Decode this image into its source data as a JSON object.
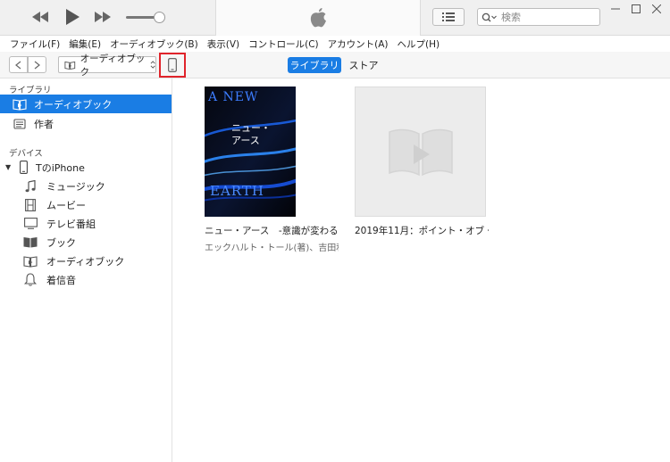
{
  "search": {
    "placeholder": "検索"
  },
  "menubar": [
    "ファイル(F)",
    "編集(E)",
    "オーディオブック(B)",
    "表示(V)",
    "コントロール(C)",
    "アカウント(A)",
    "ヘルプ(H)"
  ],
  "nav": {
    "media_kind": "オーディオブック",
    "library_label": "ライブラリ",
    "store_label": "ストア"
  },
  "sidebar": {
    "library_heading": "ライブラリ",
    "library_items": [
      {
        "label": "オーディオブック",
        "icon": "audiobook-icon",
        "selected": true
      },
      {
        "label": "作者",
        "icon": "author-icon",
        "selected": false
      }
    ],
    "devices_heading": "デバイス",
    "device_name": "TのiPhone",
    "device_items": [
      {
        "label": "ミュージック",
        "icon": "music-note-icon"
      },
      {
        "label": "ムービー",
        "icon": "film-icon"
      },
      {
        "label": "テレビ番組",
        "icon": "tv-icon"
      },
      {
        "label": "ブック",
        "icon": "book-icon"
      },
      {
        "label": "オーディオブック",
        "icon": "audiobook-icon"
      },
      {
        "label": "着信音",
        "icon": "bell-icon"
      }
    ]
  },
  "items": [
    {
      "title": "ニュー・アース　-意識が変わる...",
      "author": "エックハルト・トール(著)、吉田利...",
      "cover_text_top": "A NEW",
      "cover_text_mid": "ニュー・\nアース",
      "cover_text_bottom": "EARTH"
    },
    {
      "title": "2019年11月：ポイント・オブ・...",
      "author": ""
    }
  ],
  "colors": {
    "accent": "#1a7de4",
    "highlight_border": "#e0242b"
  }
}
